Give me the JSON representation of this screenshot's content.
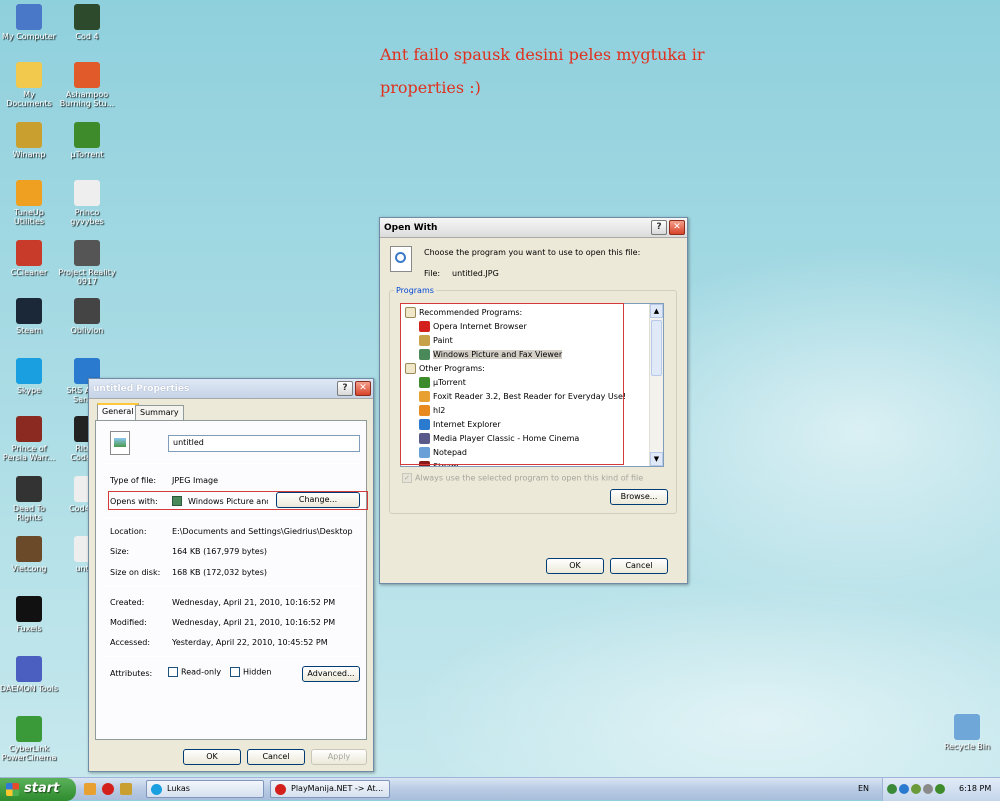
{
  "annotation": "Ant failo spausk desini peles mygtuka ir properties :)",
  "desktop_icons": [
    {
      "label": "My Computer",
      "icon": "my-computer-icon",
      "color": "#4a78c8"
    },
    {
      "label": "My Documents",
      "icon": "folder-icon",
      "color": "#f2c94c"
    },
    {
      "label": "Winamp",
      "icon": "winamp-icon",
      "color": "#c9a030"
    },
    {
      "label": "TuneUp Utilities",
      "icon": "tuneup-icon",
      "color": "#f0a020"
    },
    {
      "label": "CCleaner",
      "icon": "ccleaner-icon",
      "color": "#c83b2a"
    },
    {
      "label": "Steam",
      "icon": "steam-icon",
      "color": "#1b2838"
    },
    {
      "label": "Skype",
      "icon": "skype-icon",
      "color": "#1a9fe0"
    },
    {
      "label": "Prince of Persia Warr...",
      "icon": "prince-of-persia-icon",
      "color": "#8b2a20"
    },
    {
      "label": "Dead To Rights",
      "icon": "dead-to-rights-icon",
      "color": "#333333"
    },
    {
      "label": "Vietcong",
      "icon": "vietcong-icon",
      "color": "#6b4a2a"
    },
    {
      "label": "Fuxels",
      "icon": "fuxels-icon",
      "color": "#111111"
    },
    {
      "label": "DAEMON Tools",
      "icon": "daemon-tools-icon",
      "color": "#4a5fc0"
    },
    {
      "label": "CyberLink PowerCinema",
      "icon": "powercinema-icon",
      "color": "#3a9a3a"
    },
    {
      "label": "Cod 4",
      "icon": "cod4-icon",
      "color": "#2d4a2d"
    },
    {
      "label": "Ashampoo Burning Stu...",
      "icon": "ashampoo-icon",
      "color": "#e05a2a"
    },
    {
      "label": "µTorrent",
      "icon": "utorrent-icon",
      "color": "#3d8b2a"
    },
    {
      "label": "Princo gyvybes",
      "icon": "text-file-icon",
      "color": "#eeeeee"
    },
    {
      "label": "Project Reality 0917",
      "icon": "project-reality-icon",
      "color": "#555555"
    },
    {
      "label": "Oblivion",
      "icon": "oblivion-icon",
      "color": "#444444"
    },
    {
      "label": "SRS Audio Sand...",
      "icon": "srs-audio-icon",
      "color": "#2a7ad0"
    },
    {
      "label": "Ritmo Coden...",
      "icon": "ritmo-icon",
      "color": "#222222"
    },
    {
      "label": "Cod4 S...",
      "icon": "text-file-icon",
      "color": "#eeeeee"
    },
    {
      "label": "unti...",
      "icon": "image-file-icon",
      "color": "#eeeeee"
    },
    {
      "label": "Recycle Bin",
      "icon": "recycle-bin-icon",
      "color": "#6fa8d8"
    }
  ],
  "properties": {
    "title": "untitled Properties",
    "tabs": [
      "General",
      "Summary"
    ],
    "filename": "untitled",
    "type_label": "Type of file:",
    "type_value": "JPEG Image",
    "opens_label": "Opens with:",
    "opens_value": "Windows Picture and F",
    "change_button": "Change...",
    "location_label": "Location:",
    "location_value": "E:\\Documents and Settings\\Giedrius\\Desktop",
    "size_label": "Size:",
    "size_value": "164 KB (167,979 bytes)",
    "size_disk_label": "Size on disk:",
    "size_disk_value": "168 KB (172,032 bytes)",
    "created_label": "Created:",
    "created_value": "Wednesday, April 21, 2010, 10:16:52 PM",
    "modified_label": "Modified:",
    "modified_value": "Wednesday, April 21, 2010, 10:16:52 PM",
    "accessed_label": "Accessed:",
    "accessed_value": "Yesterday, April 22, 2010, 10:45:52 PM",
    "attributes_label": "Attributes:",
    "readonly_label": "Read-only",
    "hidden_label": "Hidden",
    "advanced_button": "Advanced...",
    "ok_button": "OK",
    "cancel_button": "Cancel",
    "apply_button": "Apply"
  },
  "open_with": {
    "title": "Open With",
    "prompt": "Choose the program you want to use to open this file:",
    "file_label": "File:",
    "file_value": "untitled.JPG",
    "programs_group": "Programs",
    "recommended_header": "Recommended Programs:",
    "recommended": [
      {
        "name": "Opera Internet Browser",
        "icon": "opera-icon",
        "color": "#d4201c",
        "selected": false
      },
      {
        "name": "Paint",
        "icon": "paint-icon",
        "color": "#c8a24a",
        "selected": false
      },
      {
        "name": "Windows Picture and Fax Viewer",
        "icon": "picture-viewer-icon",
        "color": "#4a8a5a",
        "selected": true
      }
    ],
    "other_header": "Other Programs:",
    "other": [
      {
        "name": "µTorrent",
        "icon": "utorrent-icon",
        "color": "#3d8b2a"
      },
      {
        "name": "Foxit Reader 3.2, Best Reader for Everyday Use!",
        "icon": "foxit-icon",
        "color": "#e8a030"
      },
      {
        "name": "hl2",
        "icon": "hl2-icon",
        "color": "#e88a20"
      },
      {
        "name": "Internet Explorer",
        "icon": "internet-explorer-icon",
        "color": "#2a7ad0"
      },
      {
        "name": "Media Player Classic - Home Cinema",
        "icon": "media-player-icon",
        "color": "#5a5a8a"
      },
      {
        "name": "Notepad",
        "icon": "notepad-icon",
        "color": "#6aa0d8"
      },
      {
        "name": "Steam",
        "icon": "steam-icon",
        "color": "#8a1a1a"
      }
    ],
    "always_use_label": "Always use the selected program to open this kind of file",
    "browse_button": "Browse...",
    "ok_button": "OK",
    "cancel_button": "Cancel"
  },
  "taskbar": {
    "start_label": "start",
    "tasks": [
      "Lukas",
      "PlayManija.NET -> At..."
    ],
    "language": "EN",
    "clock": "6:18 PM"
  }
}
